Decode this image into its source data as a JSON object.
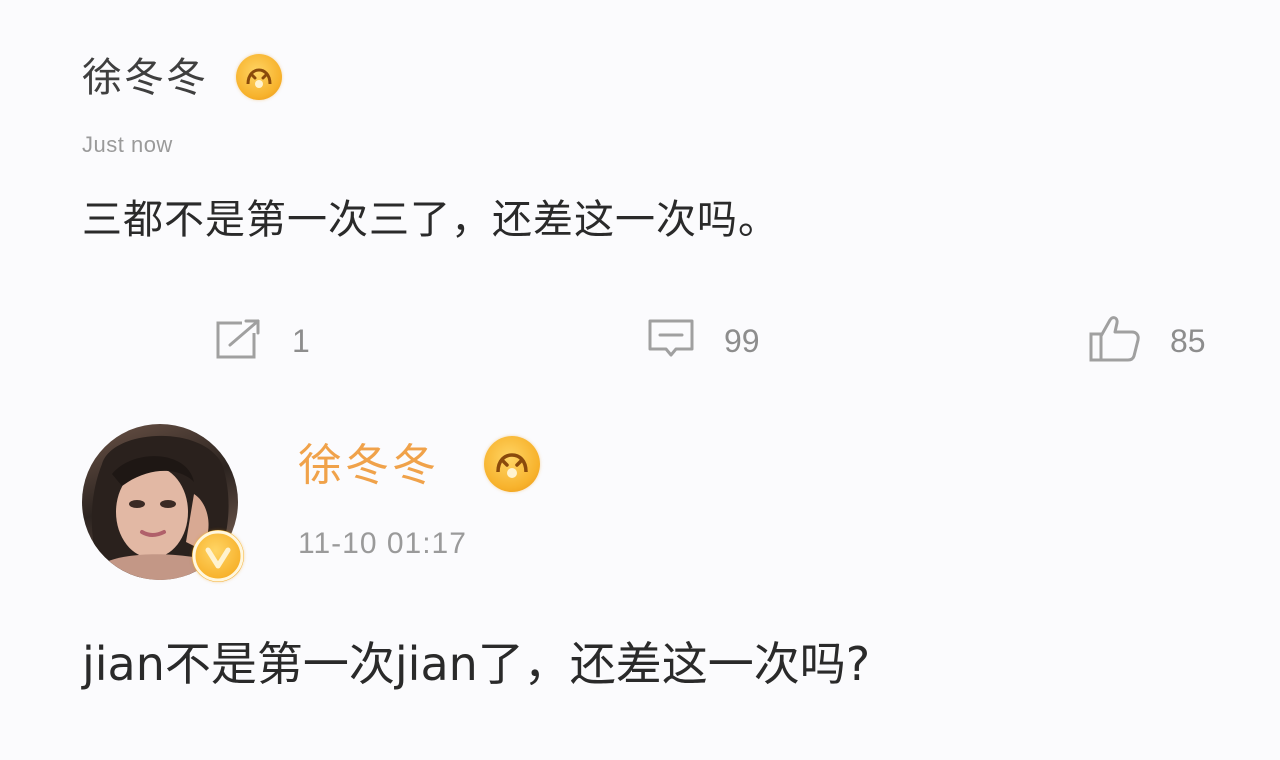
{
  "colors": {
    "background": "#fbfbfd",
    "username_vip": "#f0a24a",
    "icon_gray": "#9c9c9c",
    "badge_gold": "#f7b22c"
  },
  "post1": {
    "username": "徐冬冬",
    "badge_icon": "vip-crown-icon",
    "time": "Just now",
    "content": "三都不是第一次三了，还差这一次吗。"
  },
  "actions": {
    "repost": {
      "icon": "repost-icon",
      "count": "1"
    },
    "comment": {
      "icon": "comment-icon",
      "count": "99"
    },
    "like": {
      "icon": "thumbs-up-icon",
      "count": "85"
    }
  },
  "post2": {
    "username": "徐冬冬",
    "avatar_badge_icon": "verified-v-icon",
    "badge_icon": "vip-crown-icon",
    "time": "11-10 01:17",
    "content": "jian不是第一次jian了，还差这一次吗?"
  }
}
